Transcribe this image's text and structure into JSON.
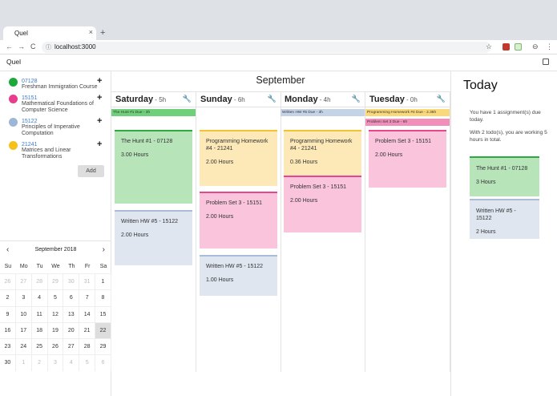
{
  "browser": {
    "tab_title": "Quel",
    "tab_close": "×",
    "new_tab": "+",
    "url": "localhost:3000",
    "nav_back": "←",
    "nav_forward": "→",
    "reload": "C",
    "info_icon": "ⓘ",
    "star": "☆",
    "profile": "⊖",
    "menu": "⋮"
  },
  "app": {
    "title": "Quel"
  },
  "sidebar": {
    "courses": [
      {
        "code": "07128",
        "name": "Freshman Immigration Course",
        "color": "#1fa83a",
        "add": "+"
      },
      {
        "code": "15151",
        "name": "Mathematical Foundations of Computer Science",
        "color": "#e83d8c",
        "add": "+"
      },
      {
        "code": "15122",
        "name": "Principles of Imperative Computation",
        "color": "#9db6d5",
        "add": "+"
      },
      {
        "code": "21241",
        "name": "Matrices and Linear Transformations",
        "color": "#f5c21b",
        "add": "+"
      }
    ],
    "add_label": "Add"
  },
  "mini_calendar": {
    "title": "September 2018",
    "prev": "‹",
    "next": "›",
    "weekdays": [
      "Su",
      "Mo",
      "Tu",
      "We",
      "Th",
      "Fr",
      "Sa"
    ],
    "days": [
      {
        "d": "26",
        "m": true
      },
      {
        "d": "27",
        "m": true
      },
      {
        "d": "28",
        "m": true
      },
      {
        "d": "29",
        "m": true
      },
      {
        "d": "30",
        "m": true
      },
      {
        "d": "31",
        "m": true
      },
      {
        "d": "1"
      },
      {
        "d": "2"
      },
      {
        "d": "3"
      },
      {
        "d": "4"
      },
      {
        "d": "5"
      },
      {
        "d": "6"
      },
      {
        "d": "7"
      },
      {
        "d": "8"
      },
      {
        "d": "9"
      },
      {
        "d": "10"
      },
      {
        "d": "11"
      },
      {
        "d": "12"
      },
      {
        "d": "13"
      },
      {
        "d": "14"
      },
      {
        "d": "15"
      },
      {
        "d": "16"
      },
      {
        "d": "17"
      },
      {
        "d": "18"
      },
      {
        "d": "19"
      },
      {
        "d": "20"
      },
      {
        "d": "21"
      },
      {
        "d": "22",
        "t": true
      },
      {
        "d": "23"
      },
      {
        "d": "24"
      },
      {
        "d": "25"
      },
      {
        "d": "26"
      },
      {
        "d": "27"
      },
      {
        "d": "28"
      },
      {
        "d": "29"
      },
      {
        "d": "30"
      },
      {
        "d": "1",
        "m": true
      },
      {
        "d": "2",
        "m": true
      },
      {
        "d": "3",
        "m": true
      },
      {
        "d": "4",
        "m": true
      },
      {
        "d": "5",
        "m": true
      },
      {
        "d": "6",
        "m": true
      }
    ]
  },
  "week": {
    "month": "September",
    "days": [
      {
        "name": "Saturday",
        "hours": " - 5h",
        "wrench": "🔧",
        "due": [
          {
            "text": "The Hunt #1 Due - 3h",
            "color": "#6fcf7a"
          }
        ],
        "cards": [
          {
            "title": "The Hunt #1 - 07128",
            "hours": "3.00 Hours",
            "bg": "#b7e4b9",
            "border": "#2eaa3f"
          },
          {
            "title": "Written HW #5 - 15122",
            "hours": "2.00 Hours",
            "bg": "#dfe6f0",
            "border": "#a9bdd8"
          }
        ]
      },
      {
        "name": "Sunday",
        "hours": " - 6h",
        "wrench": "🔧",
        "due": [],
        "cards": [
          {
            "title": "Programming Homework #4 - 21241",
            "hours": "2.00 Hours",
            "bg": "#fde9b7",
            "border": "#f1c232"
          },
          {
            "title": "Problem Set 3 - 15151",
            "hours": "2.00 Hours",
            "bg": "#f9c4dc",
            "border": "#e5478e"
          },
          {
            "title": "Written HW #5 - 15122",
            "hours": "1.00 Hours",
            "bg": "#dfe6f0",
            "border": "#a9bdd8"
          }
        ]
      },
      {
        "name": "Monday",
        "hours": " - 4h",
        "wrench": "🔧",
        "due": [
          {
            "text": "Written HW #5 Due - 3h",
            "color": "#c5d3e6"
          }
        ],
        "cards": [
          {
            "title": "Programming Homework #4 - 21241",
            "hours": "0.36 Hours",
            "bg": "#fde9b7",
            "border": "#f1c232"
          },
          {
            "title": "Problem Set 3 - 15151",
            "hours": "2.00 Hours",
            "bg": "#f9c4dc",
            "border": "#e5478e"
          }
        ]
      },
      {
        "name": "Tuesday",
        "hours": " - 0h",
        "wrench": "🔧",
        "due": [
          {
            "text": "Programming Homework #4 Due - 2.36h",
            "color": "#f9d979"
          },
          {
            "text": "Problem Set 3 Due - 6h",
            "color": "#f08fba"
          }
        ],
        "cards": [
          {
            "title": "Problem Set 3 - 15151",
            "hours": "2.00 Hours",
            "bg": "#f9c4dc",
            "border": "#e5478e"
          }
        ]
      }
    ]
  },
  "today": {
    "title": "Today",
    "assignments_text": "You have 1 assignment(s) due today.",
    "todos_text": "With 2 todo(s), you are working 5 hours in total.",
    "cards": [
      {
        "title": "The Hunt #1 - 07128",
        "hours": "3 Hours",
        "bg": "#b7e4b9",
        "border": "#2eaa3f"
      },
      {
        "title": "Written HW #5 - 15122",
        "hours": "2 Hours",
        "bg": "#dfe6f0",
        "border": "#a9bdd8"
      }
    ]
  }
}
